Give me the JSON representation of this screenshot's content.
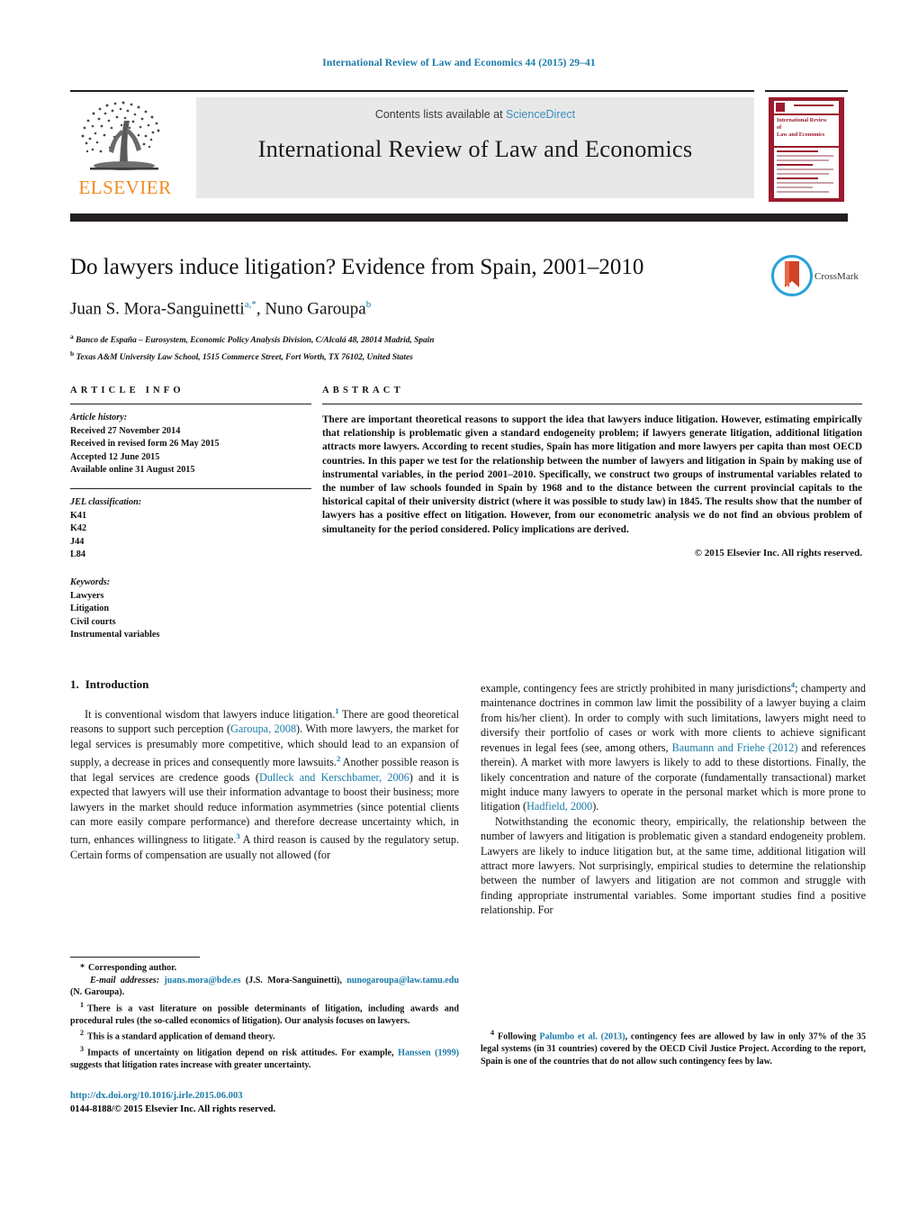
{
  "running_head": "International Review of Law and Economics 44 (2015) 29–41",
  "masthead": {
    "contents_prefix": "Contents lists available at ",
    "sciencedirect": "ScienceDirect",
    "journal_title": "International Review of Law and Economics",
    "publisher_wordmark": "ELSEVIER",
    "cover": {
      "line1": "International Review",
      "line2": "of",
      "line3": "Law and Economics"
    },
    "brand_orange": "#f28b20",
    "cover_red": "#9c1b2e",
    "link_blue": "#1a7aa8"
  },
  "article": {
    "title": "Do lawyers induce litigation? Evidence from Spain, 2001–2010",
    "authors_html": "Juan S. Mora-Sanguinetti, Nuno Garoupa",
    "author_1": "Juan S. Mora-Sanguinetti",
    "author_1_marks": "a,*",
    "author_2": "Nuno Garoupa",
    "author_2_marks": "b",
    "affiliation_a_mark": "a",
    "affiliation_a": "Banco de España – Eurosystem, Economic Policy Analysis Division, C/Alcalá 48, 28014 Madrid, Spain",
    "affiliation_b_mark": "b",
    "affiliation_b": "Texas A&M University Law School, 1515 Commerce Street, Fort Worth, TX 76102, United States",
    "crossmark_label": "CrossMark"
  },
  "article_info": {
    "heading": "ARTICLE INFO",
    "history_label": "Article history:",
    "history": [
      "Received 27 November 2014",
      "Received in revised form 26 May 2015",
      "Accepted 12 June 2015",
      "Available online 31 August 2015"
    ],
    "jel_label": "JEL classification:",
    "jel": [
      "K41",
      "K42",
      "J44",
      "L84"
    ],
    "keywords_label": "Keywords:",
    "keywords": [
      "Lawyers",
      "Litigation",
      "Civil courts",
      "Instrumental variables"
    ]
  },
  "abstract": {
    "heading": "ABSTRACT",
    "text": "There are important theoretical reasons to support the idea that lawyers induce litigation. However, estimating empirically that relationship is problematic given a standard endogeneity problem; if lawyers generate litigation, additional litigation attracts more lawyers. According to recent studies, Spain has more litigation and more lawyers per capita than most OECD countries. In this paper we test for the relationship between the number of lawyers and litigation in Spain by making use of instrumental variables, in the period 2001–2010. Specifically, we construct two groups of instrumental variables related to the number of law schools founded in Spain by 1968 and to the distance between the current provincial capitals to the historical capital of their university district (where it was possible to study law) in 1845. The results show that the number of lawyers has a positive effect on litigation. However, from our econometric analysis we do not find an obvious problem of simultaneity for the period considered. Policy implications are derived.",
    "copyright": "© 2015 Elsevier Inc. All rights reserved."
  },
  "introduction": {
    "number": "1.",
    "title": "Introduction",
    "left_p1_a": "It is conventional wisdom that lawyers induce litigation.",
    "left_p1_fn1": "1",
    "left_p1_b": " There are good theoretical reasons to support such perception (",
    "left_cite_garoupa": "Garoupa, 2008",
    "left_p1_c": "). With more lawyers, the market for legal services is presumably more competitive, which should lead to an expansion of supply, a decrease in prices and consequently more lawsuits.",
    "left_p1_fn2": "2",
    "left_p1_d": " Another possible reason is that legal services are credence goods (",
    "left_cite_dulleck": "Dulleck and Kerschbamer, 2006",
    "left_p1_e": ") and it is expected that lawyers will use their information advantage to boost their business; more lawyers in the market should reduce information asymmetries (since potential clients can more easily compare performance) and therefore decrease uncertainty which, in turn, enhances willingness to litigate.",
    "left_p1_fn3": "3",
    "left_p1_f": " A third reason is caused by the regulatory setup. Certain forms of compensation are usually not allowed (for",
    "right_p1_a": "example, contingency fees are strictly prohibited in many jurisdictions",
    "right_p1_fn4": "4",
    "right_p1_b": "; champerty and maintenance doctrines in common law limit the possibility of a lawyer buying a claim from his/her client). In order to comply with such limitations, lawyers might need to diversify their portfolio of cases or work with more clients to achieve significant revenues in legal fees (see, among others, ",
    "right_cite_baumann": "Baumann and Friehe (2012)",
    "right_p1_c": " and references therein). A market with more lawyers is likely to add to these distortions. Finally, the likely concentration and nature of the corporate (fundamentally transactional) market might induce many lawyers to operate in the personal market which is more prone to litigation (",
    "right_cite_hadfield": "Hadfield, 2000",
    "right_p1_d": ").",
    "right_p2_a": "Notwithstanding the economic theory, empirically, the relationship between the number of lawyers and litigation is problematic given a standard endogeneity problem. Lawyers are likely to induce litigation but, at the same time, additional litigation will attract more lawyers. Not surprisingly, empirical studies to determine the relationship between the number of lawyers and litigation are not common and struggle with finding appropriate instrumental variables. Some important studies find a positive relationship. For"
  },
  "footnotes": {
    "corresponding_marker": "*",
    "corresponding_text": "Corresponding author.",
    "email_label": "E-mail addresses:",
    "email_1": "juans.mora@bde.es",
    "email_1_owner": " (J.S. Mora-Sanguinetti),",
    "email_2": "nunogaroupa@law.tamu.edu",
    "email_2_owner": " (N. Garoupa).",
    "fn1_marker": "1",
    "fn1_text": "There is a vast literature on possible determinants of litigation, including awards and procedural rules (the so-called economics of litigation). Our analysis focuses on lawyers.",
    "fn2_marker": "2",
    "fn2_text": "This is a standard application of demand theory.",
    "fn3_marker": "3",
    "fn3_text_a": "Impacts of uncertainty on litigation depend on risk attitudes. For example, ",
    "fn3_cite": "Hanssen (1999)",
    "fn3_text_b": " suggests that litigation rates increase with greater uncertainty.",
    "fn4_marker": "4",
    "fn4_text_a": "Following ",
    "fn4_cite": "Palumbo et al. (2013)",
    "fn4_text_b": ", contingency fees are allowed by law in only 37% of the 35 legal systems (in 31 countries) covered by the OECD Civil Justice Project. According to the report, Spain is one of the countries that do not allow such contingency fees by law."
  },
  "footer": {
    "doi": "http://dx.doi.org/10.1016/j.irle.2015.06.003",
    "issn_line": "0144-8188/© 2015 Elsevier Inc. All rights reserved."
  }
}
